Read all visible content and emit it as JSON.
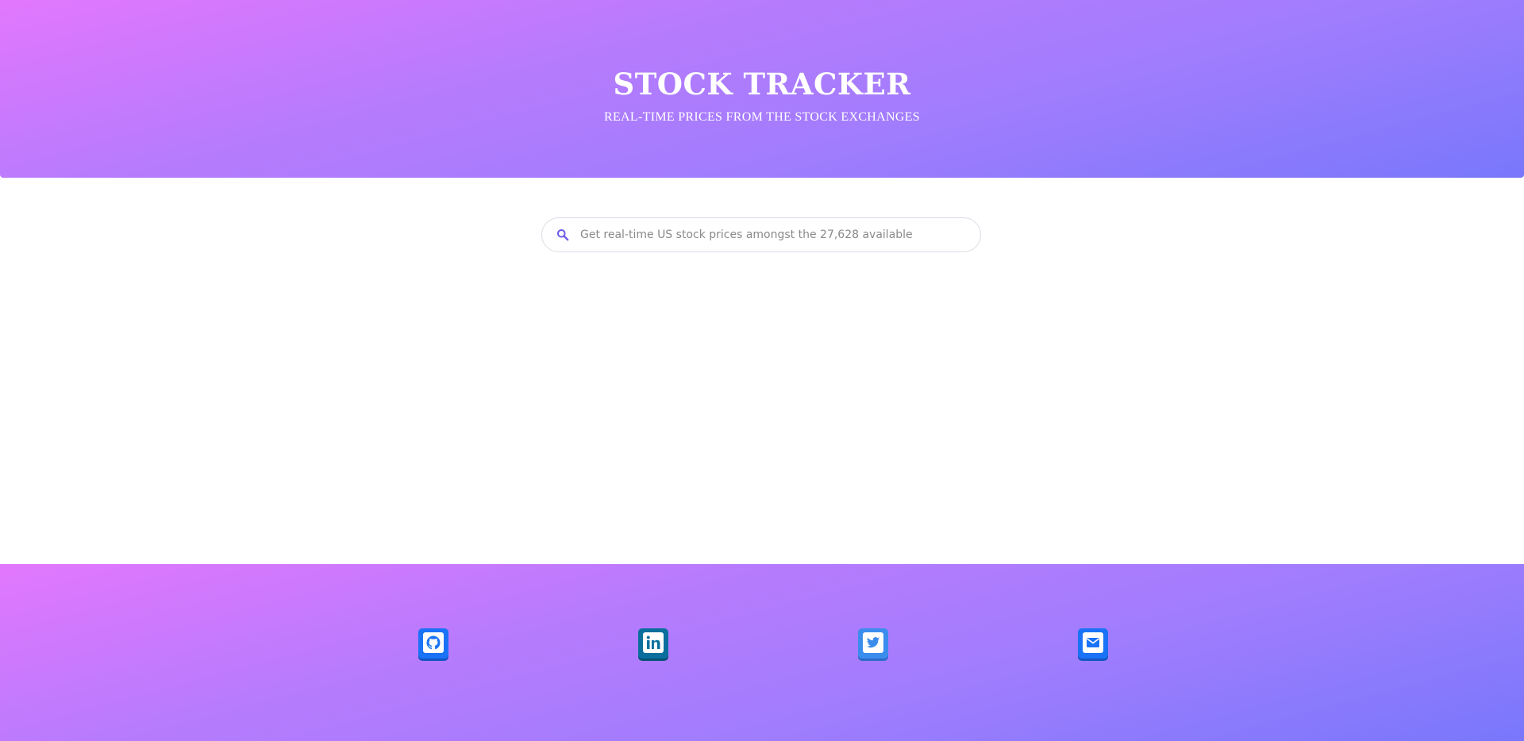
{
  "header": {
    "title": "STOCK TRACKER",
    "subtitle": "REAL-TIME PRICES FROM THE STOCK EXCHANGES"
  },
  "search": {
    "placeholder": "Get real-time US stock prices amongst the 27,628 available",
    "value": "",
    "icon": "search-icon"
  },
  "footer": {
    "links": [
      {
        "name": "github",
        "icon": "github-icon",
        "color": "#1a73f6"
      },
      {
        "name": "linkedin",
        "icon": "linkedin-icon",
        "color": "#0b6f9e"
      },
      {
        "name": "twitter",
        "icon": "twitter-icon",
        "color": "#3b8ded"
      },
      {
        "name": "email",
        "icon": "email-icon",
        "color": "#1a73f6"
      }
    ]
  },
  "colors": {
    "gradient_start": "#e277fd",
    "gradient_end": "#7977fc",
    "search_icon": "#6b5ce7"
  }
}
